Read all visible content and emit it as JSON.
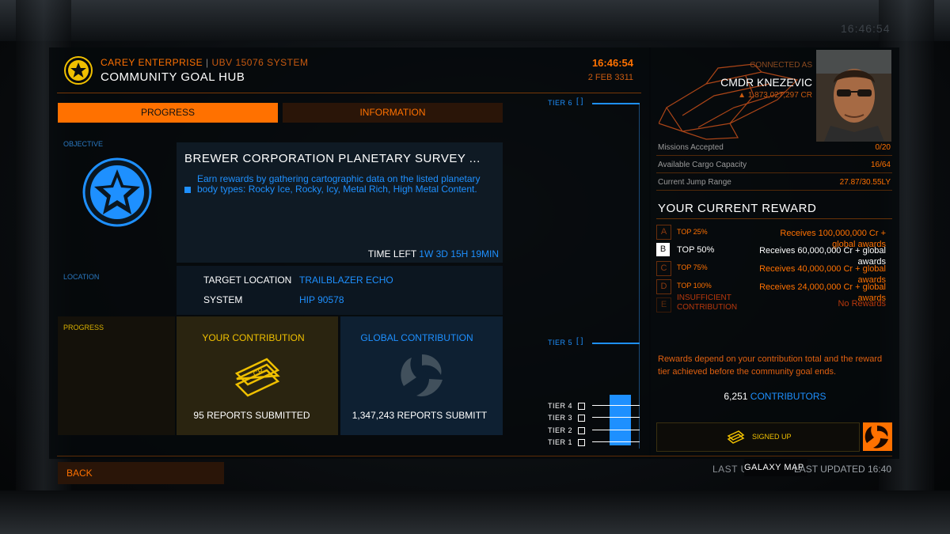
{
  "header": {
    "station": "CAREY ENTERPRISE",
    "system": "UBV 15076 SYSTEM",
    "title": "COMMUNITY GOAL HUB",
    "time": "16:46:54",
    "date": "2 FEB 3311",
    "corner_clock": "16:46:54"
  },
  "tabs": [
    {
      "label": "PROGRESS",
      "active": true
    },
    {
      "label": "INFORMATION",
      "active": false
    }
  ],
  "objective": {
    "section_label": "OBJECTIVE",
    "title": "BREWER CORPORATION PLANETARY SURVEY ...",
    "description": "Earn rewards by gathering cartographic data on the listed planetary body types: Rocky Ice, Rocky, Icy, Metal Rich, High Metal Content.",
    "time_left_label": "TIME LEFT",
    "time_left_value": "1W 3D 15H 19MIN"
  },
  "location": {
    "section_label": "LOCATION",
    "target_label": "TARGET LOCATION",
    "target_value": "TRAILBLAZER ECHO",
    "system_label": "SYSTEM",
    "system_value": "HIP 90578"
  },
  "progress": {
    "section_label": "PROGRESS",
    "your_label": "YOUR CONTRIBUTION",
    "your_value": "95 REPORTS SUBMITTED",
    "global_label": "GLOBAL CONTRIBUTION",
    "global_value": "1,347,243 REPORTS SUBMITT"
  },
  "tiers": {
    "labels": [
      "TIER 6",
      "TIER 5",
      "TIER 4",
      "TIER 3",
      "TIER 2",
      "TIER 1"
    ],
    "bracket_open": "[",
    "bracket_close": "]",
    "reached_tier": 4,
    "bar_color": "#1e90ff"
  },
  "commander": {
    "connected_label": "CONNECTED AS",
    "name": "CMDR KNEZEVIC",
    "credits": "1,873,027,297 CR"
  },
  "stats": [
    {
      "label": "Missions Accepted",
      "value": "0/20"
    },
    {
      "label": "Available Cargo Capacity",
      "value": "16/64"
    },
    {
      "label": "Current Jump Range",
      "value": "27.87/30.55LY"
    }
  ],
  "reward": {
    "title": "YOUR CURRENT REWARD",
    "tiers": [
      {
        "letter": "A",
        "pct": "TOP 25%",
        "reward": "Receives 100,000,000 Cr + global awards",
        "current": false
      },
      {
        "letter": "B",
        "pct": "TOP 50%",
        "reward": "Receives 60,000,000 Cr + global awards",
        "current": true
      },
      {
        "letter": "C",
        "pct": "TOP 75%",
        "reward": "Receives 40,000,000 Cr + global awards",
        "current": false
      },
      {
        "letter": "D",
        "pct": "TOP 100%",
        "reward": "Receives 24,000,000 Cr + global awards",
        "current": false
      },
      {
        "letter": "E",
        "pct": "INSUFFICIENT CONTRIBUTION",
        "reward": "No Rewards",
        "current": false
      }
    ],
    "note": "Rewards depend on your contribution total and the reward tier achieved before the community goal ends.",
    "contributors_count": "6,251",
    "contributors_label": "CONTRIBUTORS",
    "signed_up_label": "SIGNED UP"
  },
  "footer": {
    "back_label": "BACK",
    "galaxy_map_label": "GALAXY MAP",
    "last_updated": "LAST UPDATED 16:40",
    "overlay_text": "LAST U"
  },
  "colors": {
    "accent": "#ff7100",
    "blue": "#1e90ff",
    "gold": "#f0c000"
  }
}
